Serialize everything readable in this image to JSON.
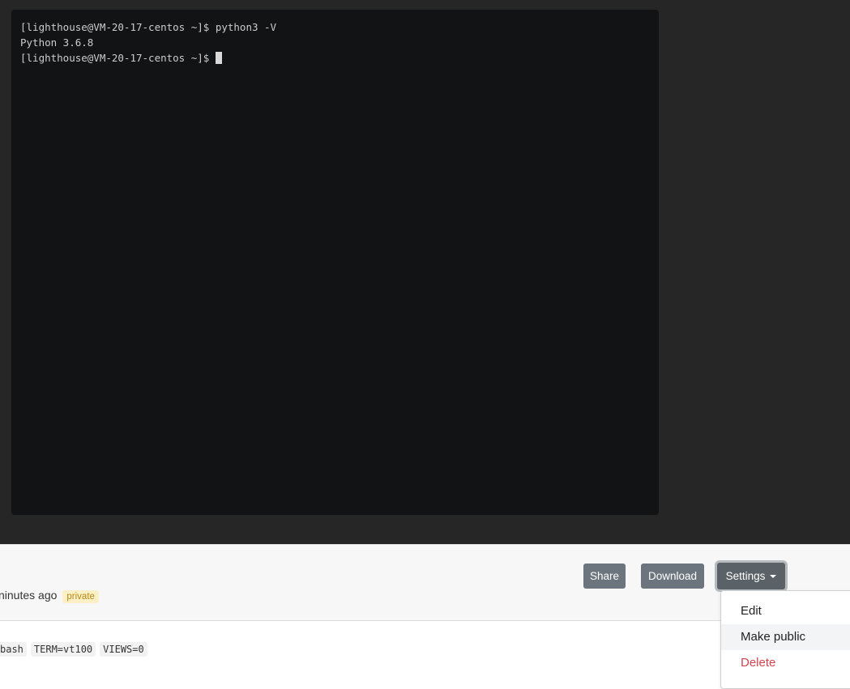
{
  "terminal": {
    "lines": [
      "[lighthouse@VM-20-17-centos ~]$ python3 -V",
      "Python 3.6.8",
      "[lighthouse@VM-20-17-centos ~]$ "
    ]
  },
  "info": {
    "time_text": "ninutes ago",
    "visibility_badge": "private"
  },
  "toolbar": {
    "share_label": "Share",
    "download_label": "Download",
    "settings_label": "Settings"
  },
  "settings_menu": {
    "items": [
      "Edit",
      "Make public",
      "Delete"
    ]
  },
  "tags": [
    "bash",
    "TERM=vt100",
    "VIEWS=0"
  ],
  "colors": {
    "terminal_bg": "#121314",
    "player_bg": "#262626",
    "button_bg": "#6c757d",
    "badge_bg": "#fdf0c6",
    "delete_text": "#d0434f"
  }
}
